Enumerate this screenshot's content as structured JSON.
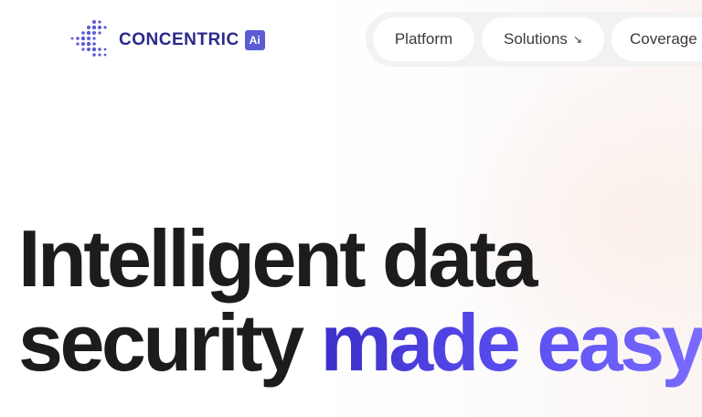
{
  "logo": {
    "name": "CONCENTRIC",
    "badge": "Ai"
  },
  "nav": {
    "items": [
      {
        "label": "Platform",
        "has_arrow": false
      },
      {
        "label": "Solutions",
        "has_arrow": true,
        "arrow_icon": "arrow-down-right-icon",
        "arrow_glyph": "↘"
      },
      {
        "label": "Coverage",
        "has_arrow": false
      }
    ]
  },
  "hero": {
    "line1": "Intelligent data",
    "line2_plain": "security ",
    "line2_accent": "made easy"
  },
  "colors": {
    "logo_text": "#2a2a8c",
    "logo_badge": "#5b5bd6",
    "accent_start": "#3b2fc9",
    "accent_end": "#7a6cff",
    "headline": "#1c1c1c",
    "nav_bg": "#f2f2f2"
  }
}
